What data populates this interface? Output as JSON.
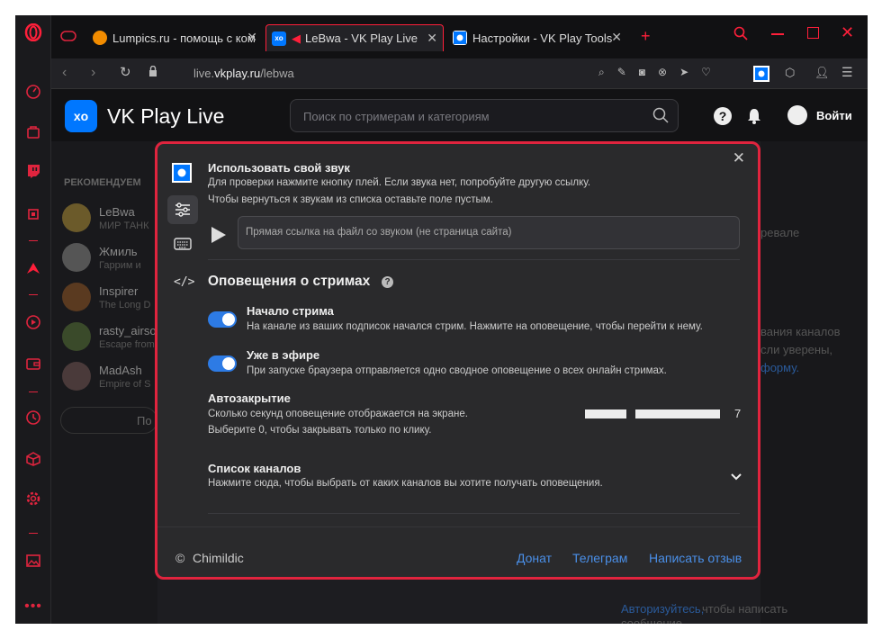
{
  "tabs": [
    {
      "label": "Lumpics.ru - помощь с ком",
      "icon": "lumpics-icon"
    },
    {
      "label": "LeBwa - VK Play Live",
      "icon": "vk-play-icon"
    },
    {
      "label": "Настройки - VK Play Tools",
      "icon": "vk-play-tools-icon"
    }
  ],
  "address": {
    "url_prefix": "live.",
    "url_domain": "vkplay.ru",
    "url_path": "/lebwa"
  },
  "header": {
    "logo_text": "VK Play Live",
    "search_placeholder": "Поиск по стримерам и категориям",
    "login_label": "Войти"
  },
  "sidebar": {
    "title": "РЕКОМЕНДУЕМ",
    "items": [
      {
        "name": "LeBwa",
        "sub": "МИР ТАНК"
      },
      {
        "name": "Жмиль",
        "sub": "Гаррим и"
      },
      {
        "name": "Inspirer",
        "sub": "The Long D"
      },
      {
        "name": "rasty_airso",
        "sub": "Escape from"
      },
      {
        "name": "MadAsh",
        "sub": "Empire of S"
      }
    ],
    "more_label": "По"
  },
  "right_bg": {
    "text1": "ревале",
    "text2": "вания каналов",
    "text3": "сли уверены,",
    "text4": "форму.",
    "auth_link": "Авторизуйтесь,",
    "auth_text": "чтобы написать",
    "auth_text2": "сообщение"
  },
  "modal": {
    "sound": {
      "title": "Использовать свой звук",
      "desc1": "Для проверки нажмите кнопку плей. Если звука нет, попробуйте другую ссылку.",
      "desc2": "Чтобы вернуться к звукам из списка оставьте поле пустым.",
      "input_placeholder": "Прямая ссылка на файл со звуком (не страница сайта)"
    },
    "notifications": {
      "title": "Оповещения о стримах",
      "start": {
        "title": "Начало стрима",
        "desc": "На канале из ваших подписок начался стрим. Нажмите на оповещение, чтобы перейти к нему.",
        "enabled": true
      },
      "live": {
        "title": "Уже в эфире",
        "desc": "При запуске браузера отправляется одно сводное оповещение о всех онлайн стримах.",
        "enabled": true
      },
      "autoclose": {
        "title": "Автозакрытие",
        "desc1": "Сколько секунд оповещение отображается на экране.",
        "desc2": "Выберите 0, чтобы закрывать только по клику.",
        "value": "7",
        "level": 0.33
      },
      "channels": {
        "title": "Список каналов",
        "desc": "Нажмите сюда, чтобы выбрать от каких каналов вы хотите получать оповещения."
      }
    },
    "footer": {
      "copyright": "©",
      "author": "Chimildic",
      "donate": "Донат",
      "telegram": "Телеграм",
      "review": "Написать отзыв"
    }
  },
  "colors": {
    "accent": "#e0243e",
    "link": "#4a8fe8",
    "toggle": "#2d7be5",
    "vk_blue": "#0077ff"
  }
}
